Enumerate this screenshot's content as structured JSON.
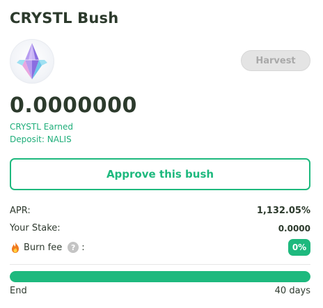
{
  "title": "CRYSTL Bush",
  "logo": {
    "icon": "crystal-icon",
    "colors": {
      "violet": "#9b7fe8",
      "blue": "#84d7f0",
      "pink": "#e9a6e0"
    }
  },
  "harvest": {
    "label": "Harvest",
    "enabled": false
  },
  "earned": {
    "value": "0.0000000",
    "label": "CRYSTL Earned"
  },
  "deposit": {
    "label": "Deposit: NALIS"
  },
  "approve": {
    "label": "Approve this bush"
  },
  "stats": {
    "apr": {
      "label": "APR:",
      "value": "1,132.05%"
    },
    "stake": {
      "label": "Your Stake:",
      "value": "0.0000"
    },
    "burn": {
      "icon": "fire-icon",
      "label": "Burn fee",
      "help_icon": "question-icon",
      "help_glyph": "?",
      "colon": ":",
      "value": "0%"
    }
  },
  "progress": {
    "fraction": 1.0,
    "end_label": "End",
    "remaining": "40 days"
  },
  "colors": {
    "accent": "#1eb97e",
    "accent_text": "#1fae7a",
    "disabled_bg": "#e4e4e4",
    "title": "#2c3a2c"
  }
}
